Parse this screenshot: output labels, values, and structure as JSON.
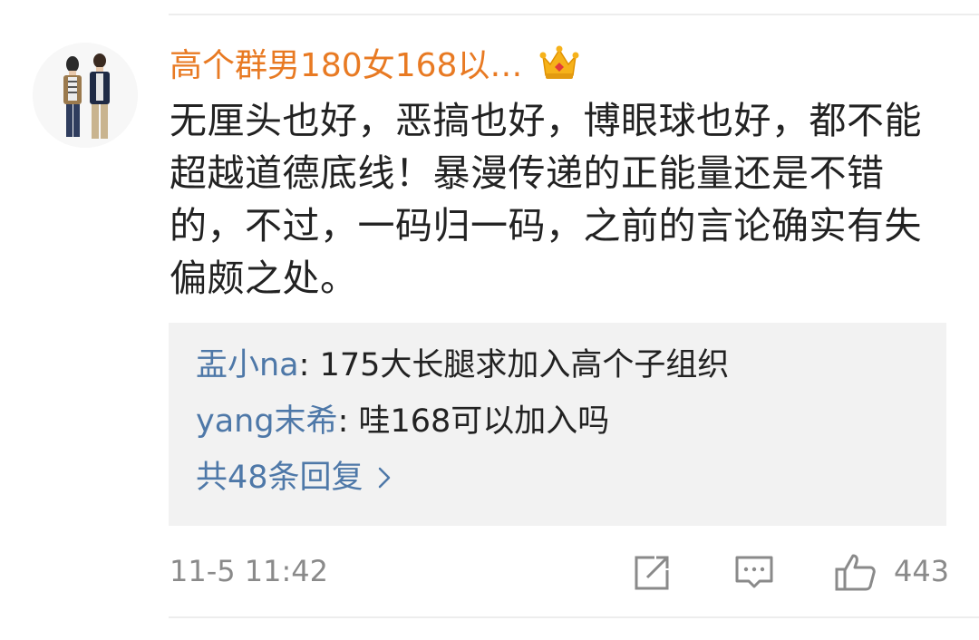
{
  "comment": {
    "username": "高个群男180女168以…",
    "badge_icon": "crown-icon",
    "text": "无厘头也好，恶搞也好，博眼球也好，都不能超越道德底线！暴漫传递的正能量还是不错的，不过，一码归一码，之前的言论确实有失偏颇之处。",
    "timestamp": "11-5 11:42",
    "like_count": "443"
  },
  "replies": [
    {
      "user": "盂小na",
      "separator": ": ",
      "content": "175大长腿求加入高个子组织"
    },
    {
      "user": "yang末希",
      "separator": ": ",
      "content": "哇168可以加入吗"
    }
  ],
  "more_replies_label": "共48条回复",
  "colors": {
    "username": "#e87a23",
    "link": "#4e78a8",
    "text": "#222222",
    "meta": "#8a8a8a",
    "reply_bg": "#f2f2f2"
  }
}
